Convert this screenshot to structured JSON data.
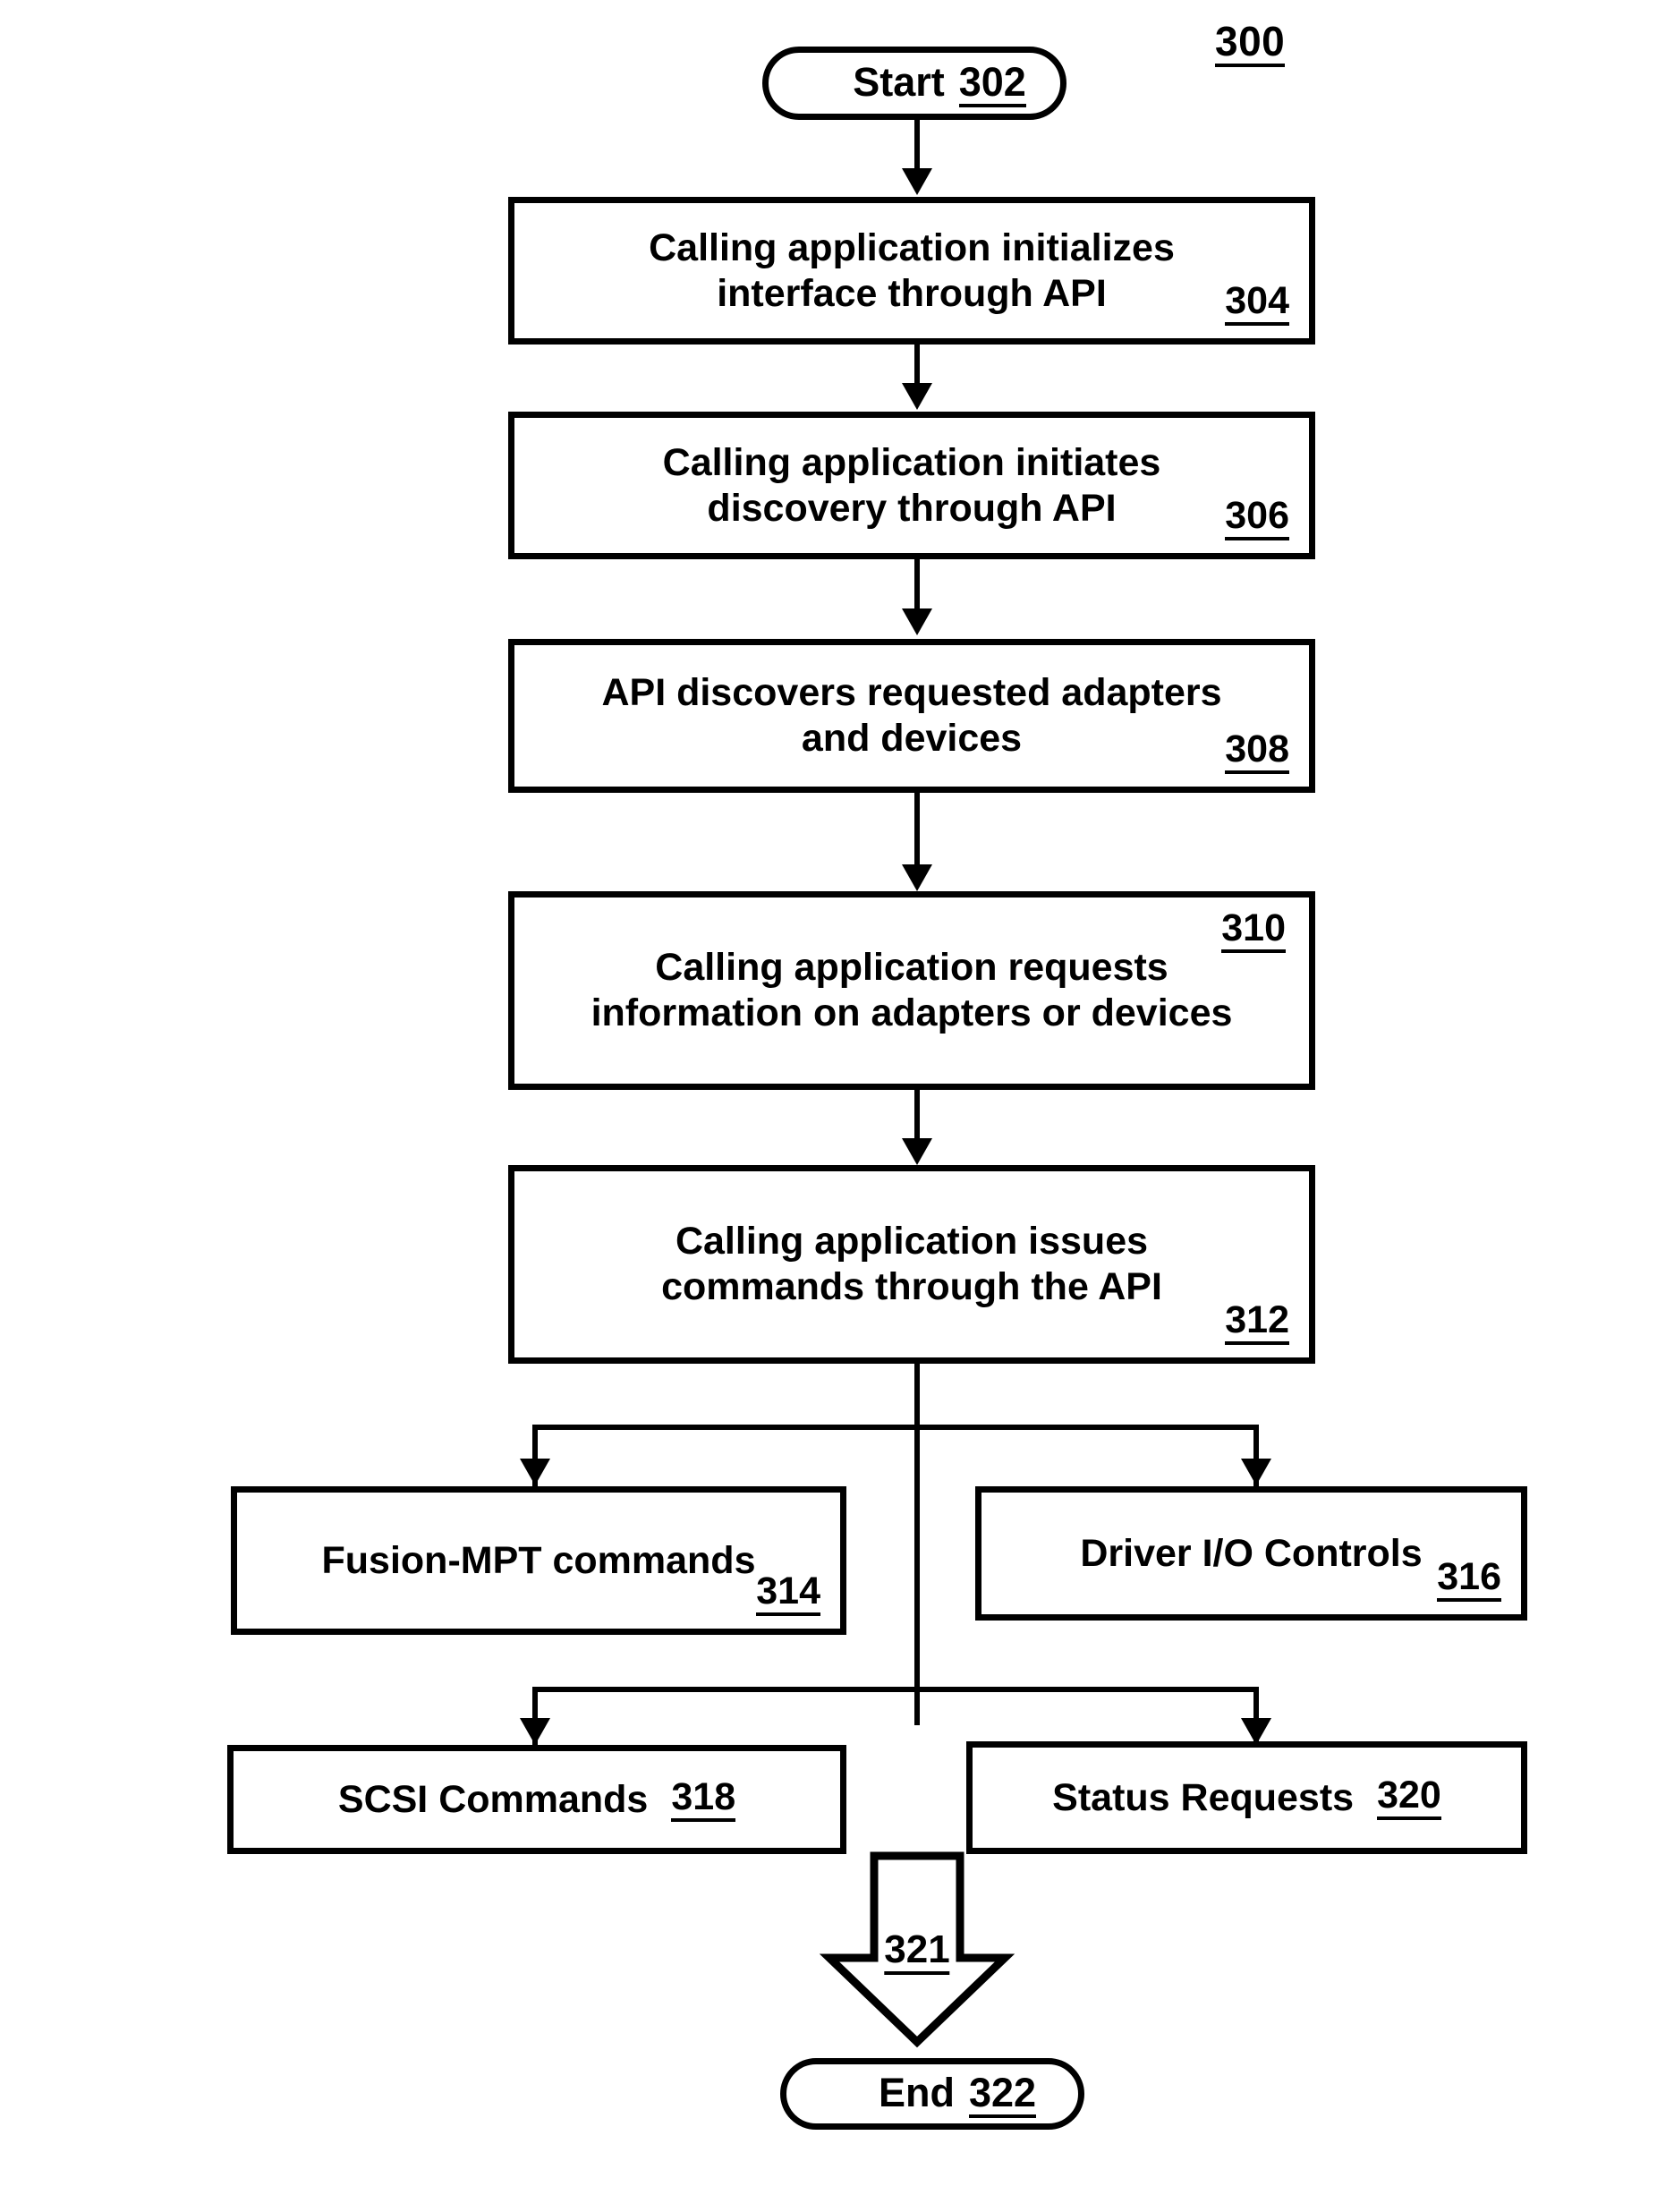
{
  "figure": {
    "number": "300"
  },
  "nodes": {
    "start": {
      "label": "Start",
      "ref": "302"
    },
    "step_304": {
      "line1": "Calling application initializes",
      "line2": "interface through API",
      "ref": "304"
    },
    "step_306": {
      "line1": "Calling application initiates",
      "line2": "discovery through API",
      "ref": "306"
    },
    "step_308": {
      "line1": "API discovers requested adapters",
      "line2": "and devices",
      "ref": "308"
    },
    "step_310": {
      "line1": "Calling application requests",
      "line2": "information on adapters or devices",
      "ref": "310"
    },
    "step_312": {
      "line1": "Calling application issues",
      "line2": "commands through the API",
      "ref": "312"
    },
    "step_314": {
      "label": "Fusion-MPT commands",
      "ref": "314"
    },
    "step_316": {
      "label": "Driver I/O Controls",
      "ref": "316"
    },
    "step_318": {
      "label": "SCSI Commands",
      "ref": "318"
    },
    "step_320": {
      "label": "Status Requests",
      "ref": "320"
    },
    "block_arrow": {
      "ref": "321"
    },
    "end": {
      "label": "End",
      "ref": "322"
    }
  },
  "colors": {
    "stroke": "#000000",
    "background": "#ffffff"
  }
}
